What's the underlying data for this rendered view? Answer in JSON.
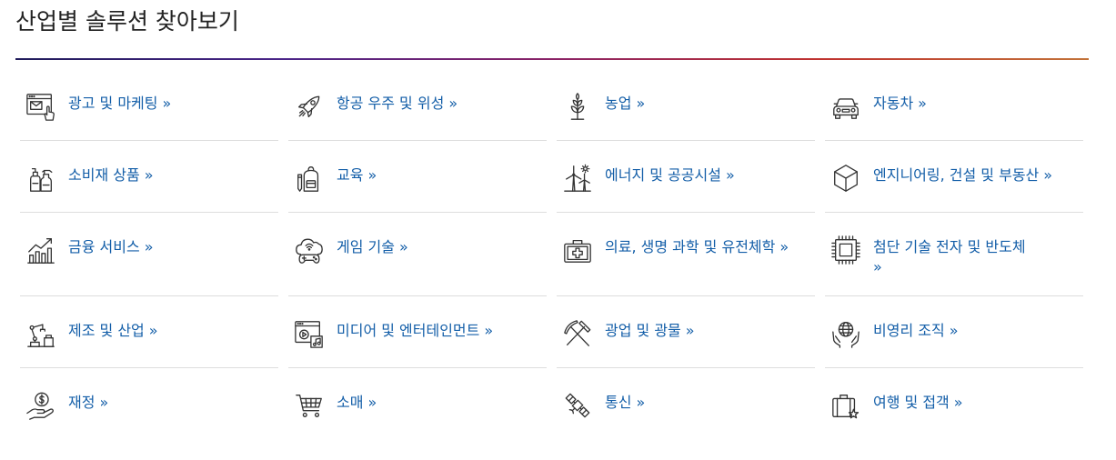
{
  "section": {
    "title": "산업별 솔루션 찾아보기",
    "link_arrow": "»"
  },
  "colors": {
    "title": "#232323",
    "link": "#135ea8",
    "icon_stroke": "#333333",
    "divider": "#dddddd",
    "accent_gradient": [
      "#1f1b5a",
      "#4a2488",
      "#8a2266",
      "#c0322f",
      "#c27238"
    ]
  },
  "industries": [
    {
      "label": "광고 및 마케팅",
      "icon": "browser-envelope-cursor-icon"
    },
    {
      "label": "항공 우주 및 위성",
      "icon": "rocket-icon"
    },
    {
      "label": "농업",
      "icon": "plant-sprout-icon"
    },
    {
      "label": "자동차",
      "icon": "car-icon"
    },
    {
      "label": "소비재 상품",
      "icon": "bottles-icon"
    },
    {
      "label": "교육",
      "icon": "backpack-pencil-icon"
    },
    {
      "label": "에너지 및 공공시설",
      "icon": "wind-turbine-icon"
    },
    {
      "label": "엔지니어링, 건설 및 부동산",
      "icon": "cube-icon"
    },
    {
      "label": "금융 서비스",
      "icon": "bar-chart-growth-icon"
    },
    {
      "label": "게임 기술",
      "icon": "cloud-gamepad-icon"
    },
    {
      "label": "의료, 생명 과학 및 유전체학",
      "icon": "first-aid-kit-icon"
    },
    {
      "label": "첨단 기술 전자 및 반도체",
      "icon": "microchip-icon"
    },
    {
      "label": "제조 및 산업",
      "icon": "robotic-arm-icon"
    },
    {
      "label": "미디어 및 엔터테인먼트",
      "icon": "media-player-icon"
    },
    {
      "label": "광업 및 광물",
      "icon": "pickaxe-hammer-icon"
    },
    {
      "label": "비영리 조직",
      "icon": "globe-hands-icon"
    },
    {
      "label": "재정",
      "icon": "hand-coin-icon"
    },
    {
      "label": "소매",
      "icon": "shopping-cart-icon"
    },
    {
      "label": "통신",
      "icon": "satellite-icon"
    },
    {
      "label": "여행 및 접객",
      "icon": "suitcase-star-icon"
    }
  ]
}
